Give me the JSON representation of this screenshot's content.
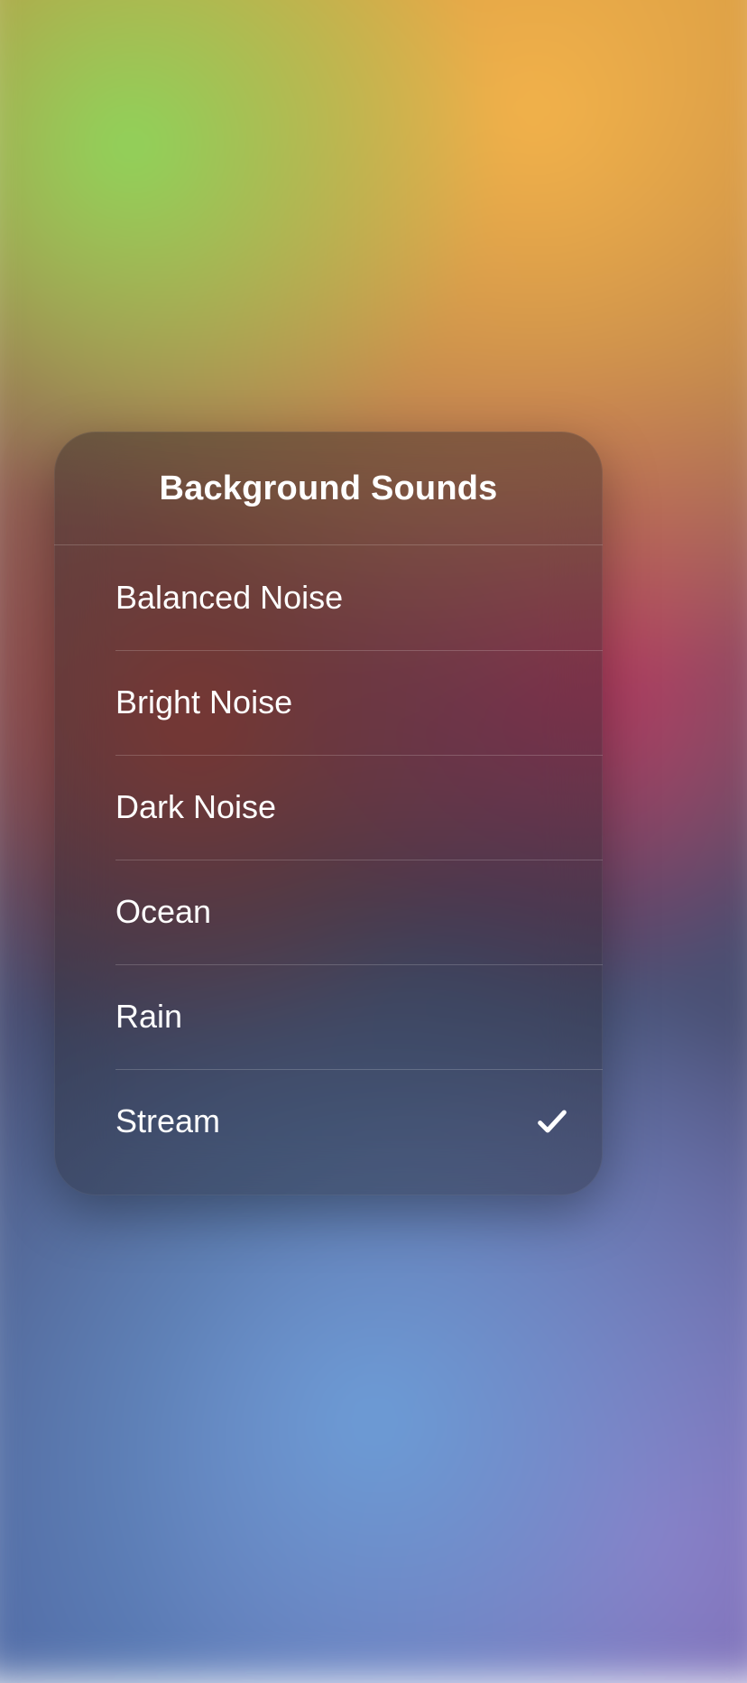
{
  "panel": {
    "title": "Background Sounds",
    "items": [
      {
        "label": "Balanced Noise",
        "selected": false
      },
      {
        "label": "Bright Noise",
        "selected": false
      },
      {
        "label": "Dark Noise",
        "selected": false
      },
      {
        "label": "Ocean",
        "selected": false
      },
      {
        "label": "Rain",
        "selected": false
      },
      {
        "label": "Stream",
        "selected": true
      }
    ]
  }
}
